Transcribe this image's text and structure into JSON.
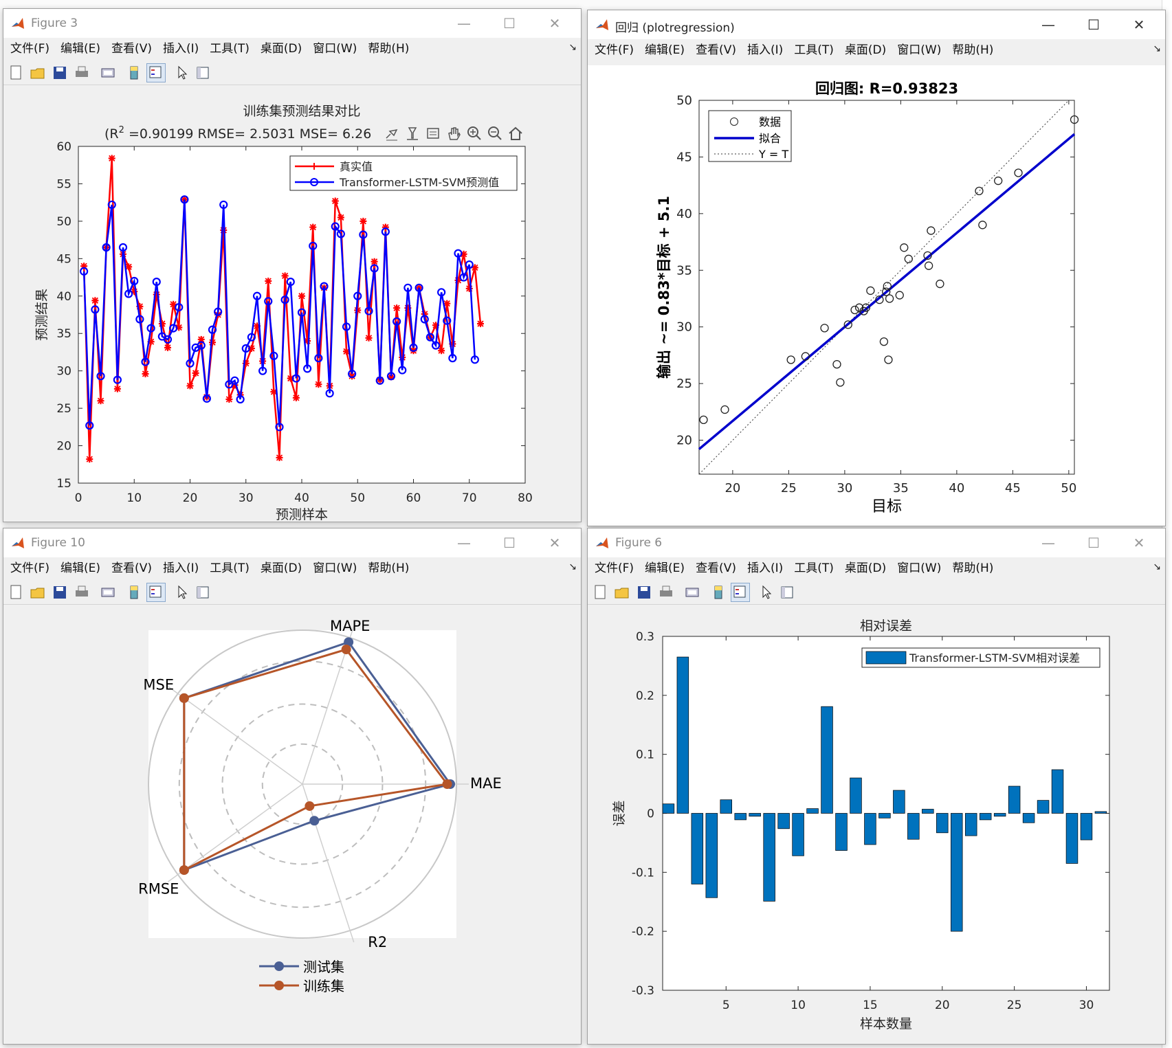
{
  "menus": [
    "文件(F)",
    "编辑(E)",
    "查看(V)",
    "插入(I)",
    "工具(T)",
    "桌面(D)",
    "窗口(W)",
    "帮助(H)"
  ],
  "fig3": {
    "window_title": "Figure 3",
    "title_line1": "训练集预测结果对比",
    "title_line2_prefix": "(R",
    "title_sup": "2",
    "title_line2_rest": " =0.90199 RMSE= 2.5031 MSE= 6.26",
    "chart_data": {
      "type": "line",
      "xlabel": "预测样本",
      "ylabel": "预测结果",
      "xlim": [
        0,
        80
      ],
      "ylim": [
        15,
        60
      ],
      "xticks": [
        0,
        10,
        20,
        30,
        40,
        50,
        60,
        70,
        80
      ],
      "yticks": [
        15,
        20,
        25,
        30,
        35,
        40,
        45,
        50,
        55,
        60
      ],
      "legend": "top-right",
      "series": [
        {
          "name": "真实值",
          "color": "#ff0000",
          "marker": "*",
          "values": [
            44.0,
            18.2,
            39.4,
            26.0,
            46.5,
            58.4,
            27.6,
            45.6,
            43.9,
            40.6,
            38.6,
            29.6,
            33.9,
            40.2,
            36.3,
            33.1,
            38.9,
            35.8,
            52.9,
            28.0,
            29.7,
            34.2,
            26.5,
            33.8,
            37.5,
            48.8,
            26.2,
            28.1,
            26.8,
            31.0,
            33.0,
            36.0,
            31.3,
            42.0,
            27.2,
            18.4,
            42.7,
            29.0,
            26.4,
            40.0,
            34.0,
            49.2,
            28.2,
            41.1,
            28.0,
            52.7,
            50.5,
            32.6,
            29.3,
            38.1,
            50.0,
            34.4,
            44.6,
            28.8,
            49.2,
            29.2,
            38.4,
            31.8,
            38.4,
            32.7,
            41.1,
            37.6,
            34.5,
            36.1,
            32.7,
            39.0,
            33.6,
            42.1,
            45.6,
            41.0,
            43.8,
            36.3
          ]
        },
        {
          "name": "Transformer-LSTM-SVM预测值",
          "color": "#0000ff",
          "marker": "o",
          "values": [
            43.3,
            22.7,
            38.2,
            29.3,
            46.5,
            52.2,
            28.8,
            46.5,
            40.3,
            42.0,
            36.9,
            31.2,
            35.7,
            41.9,
            34.6,
            34.2,
            35.7,
            38.5,
            52.9,
            31.0,
            33.1,
            33.4,
            26.3,
            35.5,
            37.9,
            52.2,
            28.2,
            28.7,
            26.2,
            33.0,
            34.5,
            40.0,
            30.0,
            39.3,
            32.0,
            22.5,
            39.5,
            41.9,
            29.0,
            37.8,
            30.3,
            46.7,
            31.7,
            41.3,
            27.0,
            49.3,
            48.3,
            35.9,
            29.6,
            40.0,
            48.2,
            38.0,
            43.7,
            28.7,
            48.6,
            29.3,
            36.6,
            30.1,
            41.1,
            33.1,
            41.1,
            36.9,
            34.5,
            33.4,
            40.5,
            36.7,
            31.7,
            45.7,
            42.5,
            44.2,
            31.5
          ]
        }
      ]
    }
  },
  "regression": {
    "window_title": "回归 (plotregression)",
    "chart_data": {
      "type": "scatter",
      "title": "回归图: R=0.93823",
      "xlabel": "目标",
      "ylabel": "输出 ~= 0.83*目标 + 5.1",
      "xlim": [
        17,
        50.5
      ],
      "ylim": [
        17,
        50
      ],
      "xticks": [
        20,
        25,
        30,
        35,
        40,
        45,
        50
      ],
      "yticks": [
        20,
        25,
        30,
        35,
        40,
        45,
        50
      ],
      "legend": "top-left",
      "legend_entries": [
        "数据",
        "拟合",
        "Y = T"
      ],
      "fit": {
        "slope": 0.83,
        "intercept": 5.1
      },
      "x": [
        17.4,
        19.3,
        25.2,
        26.5,
        28.2,
        29.3,
        29.6,
        30.3,
        30.9,
        31.3,
        31.7,
        31.9,
        32.3,
        33.1,
        33.5,
        33.7,
        33.8,
        33.9,
        34.0,
        34.9,
        35.3,
        35.7,
        37.4,
        37.5,
        37.7,
        38.5,
        42.0,
        42.3,
        43.7,
        45.5,
        50.5
      ],
      "y": [
        21.8,
        22.7,
        27.1,
        27.4,
        29.9,
        26.7,
        25.1,
        30.2,
        31.5,
        31.7,
        31.4,
        31.7,
        33.2,
        32.4,
        28.7,
        33.1,
        33.6,
        27.1,
        32.5,
        32.8,
        37.0,
        36.0,
        36.3,
        35.4,
        38.5,
        33.8,
        42.0,
        39.0,
        42.9,
        43.6,
        48.3
      ]
    }
  },
  "fig10": {
    "window_title": "Figure 10",
    "chart_data": {
      "type": "radar",
      "axes": [
        "MAE",
        "MAPE",
        "MSE",
        "RMSE",
        "R2"
      ],
      "legend": "bottom",
      "series": [
        {
          "name": "测试集",
          "color": "#4a5f94",
          "values": [
            0.96,
            0.97,
            0.95,
            0.95,
            0.25
          ]
        },
        {
          "name": "训练集",
          "color": "#b65528",
          "values": [
            0.94,
            0.92,
            0.95,
            0.95,
            0.15
          ]
        }
      ]
    }
  },
  "fig6": {
    "window_title": "Figure 6",
    "chart_data": {
      "type": "bar",
      "title": "相对误差",
      "xlabel": "样本数量",
      "ylabel": "误差",
      "xlim": [
        0.6,
        31.6
      ],
      "ylim": [
        -0.3,
        0.3
      ],
      "xticks": [
        5,
        10,
        15,
        20,
        25,
        30
      ],
      "yticks": [
        -0.3,
        -0.2,
        -0.1,
        0,
        0.1,
        0.2,
        0.3
      ],
      "legend": "top-right",
      "series": [
        {
          "name": "Transformer-LSTM-SVM相对误差",
          "color": "#0072bd",
          "values": [
            0.016,
            0.265,
            -0.12,
            -0.143,
            0.023,
            -0.011,
            -0.005,
            -0.149,
            -0.026,
            -0.072,
            0.008,
            0.181,
            -0.063,
            0.06,
            -0.053,
            -0.008,
            0.039,
            -0.044,
            0.007,
            -0.033,
            -0.2,
            -0.038,
            -0.011,
            -0.005,
            0.046,
            -0.016,
            0.022,
            0.074,
            -0.085,
            -0.045,
            0.003
          ]
        }
      ]
    }
  }
}
